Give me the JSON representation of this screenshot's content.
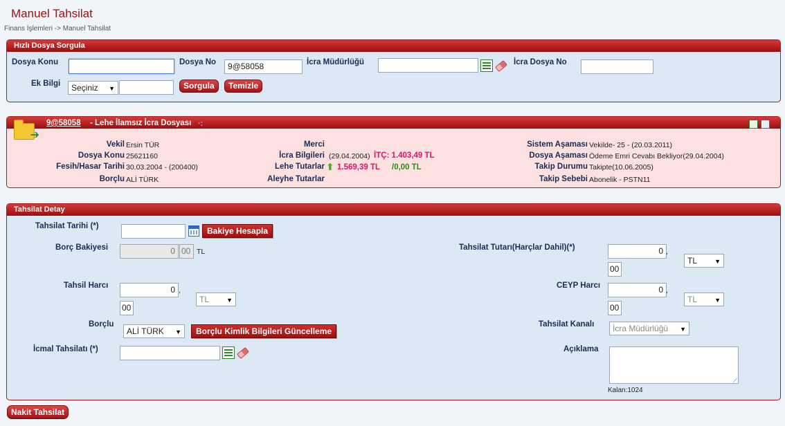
{
  "page": {
    "title": "Manuel Tahsilat",
    "breadcrumb": "Finans İşlemleri -> Manuel Tahsilat"
  },
  "quick_search": {
    "header": "Hızlı Dosya Sorgula",
    "dosya_konu_label": "Dosya Konu",
    "dosya_konu_value": "",
    "dosya_no_label": "Dosya No",
    "dosya_no_value": "9@58058",
    "icra_mudurlugu_label": "İcra Müdürlüğü",
    "icra_mudurlugu_value": "",
    "icra_dosya_no_label": "İcra Dosya No",
    "icra_dosya_no_value": "",
    "ek_bilgi_label": "Ek Bilgi",
    "ek_bilgi_select": "Seçiniz",
    "ek_bilgi_value": "",
    "sorgula_label": "Sorgula",
    "temizle_label": "Temizle"
  },
  "file_info": {
    "file_no": "9@58058",
    "file_desc": "- Lehe İlamsız İcra Dosyası",
    "vekil_label": "Vekil",
    "vekil_value": "Ersin TÜR",
    "dosya_konu_label": "Dosya Konu",
    "dosya_konu_value": "25621160",
    "fesih_label": "Fesih/Hasar Tarihi",
    "fesih_value": "30.03.2004 - (200400)",
    "borclu_label": "Borçlu",
    "borclu_value": "ALİ TÜRK",
    "merci_label": "Merci",
    "icra_bilgileri_label": "İcra Bilgileri",
    "icra_bilgileri_date": "(29.04.2004)",
    "icra_bilgileri_itc": "İTÇ: 1.403,49 TL",
    "lehe_tutarlar_label": "Lehe Tutarlar",
    "lehe_tutar_1": "1.569,39 TL",
    "lehe_tutar_2": "/0,00 TL",
    "aleyhe_tutarlar_label": "Aleyhe Tutarlar",
    "sistem_asamasi_label": "Sistem Aşaması",
    "sistem_asamasi_value": "Vekilde- 25 - (20.03.2011)",
    "dosya_asamasi_label": "Dosya Aşaması",
    "dosya_asamasi_value": "Ödeme Emri Cevabı Bekliyor(29.04.2004)",
    "takip_durumu_label": "Takip Durumu",
    "takip_durumu_value": "Takipte(10.06.2005)",
    "takip_sebebi_label": "Takip Sebebi",
    "takip_sebebi_value": "Abonelik - PSTN11"
  },
  "tahsilat": {
    "header": "Tahsilat Detay",
    "tahsilat_tarihi_label": "Tahsilat Tarihi (*)",
    "tahsilat_tarihi_value": "",
    "bakiye_hesapla_label": "Bakiye Hesapla",
    "borc_bakiyesi_label": "Borç Bakiyesi",
    "borc_bakiyesi_int": "0",
    "borc_bakiyesi_dec": "00",
    "borc_bakiyesi_currency": "TL",
    "tahsil_harci_label": "Tahsil Harcı",
    "tahsil_harci_int": "0",
    "tahsil_harci_dec": "00",
    "tahsil_harci_currency": "TL",
    "borclu_label": "Borçlu",
    "borclu_value": "ALİ TÜRK",
    "borclu_kimlik_label": "Borçlu Kimlik Bilgileri Güncelleme",
    "icmal_label": "İcmal Tahsilatı (*)",
    "icmal_value": "",
    "tahsilat_tutari_label": "Tahsilat Tutarı(Harçlar Dahil)(*)",
    "tahsilat_tutari_int": "0",
    "tahsilat_tutari_dec": "00",
    "tahsilat_tutari_currency": "TL",
    "ceyp_label": "CEYP Harcı",
    "ceyp_int": "0",
    "ceyp_dec": "00",
    "ceyp_currency": "TL",
    "kanal_label": "Tahsilat Kanalı",
    "kanal_value": "İcra Müdürlüğü",
    "aciklama_label": "Açıklama",
    "aciklama_value": "",
    "kalan_label": "Kalan:1024",
    "comma": ","
  },
  "footer": {
    "nakit_tahsilat_label": "Nakit Tahsilat"
  }
}
